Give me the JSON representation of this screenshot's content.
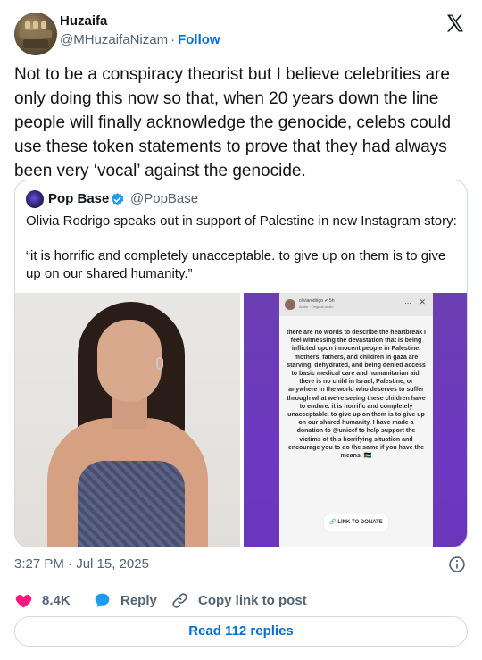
{
  "author": {
    "name": "Huzaifa",
    "handle": "@MHuzaifaNizam",
    "separator": "·",
    "follow_label": "Follow"
  },
  "tweet": {
    "text": "Not to be a conspiracy theorist but I believe celebrities are only doing this now so that, when 20 years down the line people will finally acknowledge the genocide, celebs could use these token statements to prove that they had always been very ‘vocal’ against the genocide.",
    "timestamp": "3:27 PM · Jul 15, 2025"
  },
  "quote": {
    "name": "Pop Base",
    "handle": "@PopBase",
    "text": "Olivia Rodrigo speaks out in support of Palestine in new Instagram story:",
    "quote_text": "“it is horrific and completely unacceptable. to give up on them is to give up on our shared humanity.”",
    "story": {
      "username": "oliviarodrigo ✔ 5h",
      "subtitle": "Audio · Original audio",
      "body": "there are no words to describe the heartbreak I feel witnessing the devastation that is being inflicted upon innocent people in Palestine. mothers, fathers, and children in gaza are starving, dehydrated, and being denied access to basic medical care and humanitarian aid. there is no child in Israel, Palestine, or anywhere in the world who deserves to suffer through what we're seeing these children have to endure. it is horrific and completely unacceptable. to give up on them is to give up on our shared humanity. I have made a donation to @unicef to help support the victims of this horrifying situation and encourage you to do the same if you have the means. 🇵🇸",
      "link_label": "🔗 LINK TO DONATE"
    }
  },
  "actions": {
    "likes": "8.4K",
    "reply_label": "Reply",
    "copy_label": "Copy link to post",
    "read_replies": "Read 112 replies"
  },
  "colors": {
    "accent": "#006fd6",
    "like": "#f91880",
    "verified": "#1d9bf0",
    "muted": "#536471",
    "border": "#cfd9de",
    "story_bg": "#6b3fb3"
  },
  "icons": {
    "x_logo": "x-logo-icon",
    "verified": "verified-badge-icon",
    "info": "info-icon",
    "heart": "heart-icon",
    "reply": "reply-bubble-icon",
    "link": "link-icon"
  }
}
